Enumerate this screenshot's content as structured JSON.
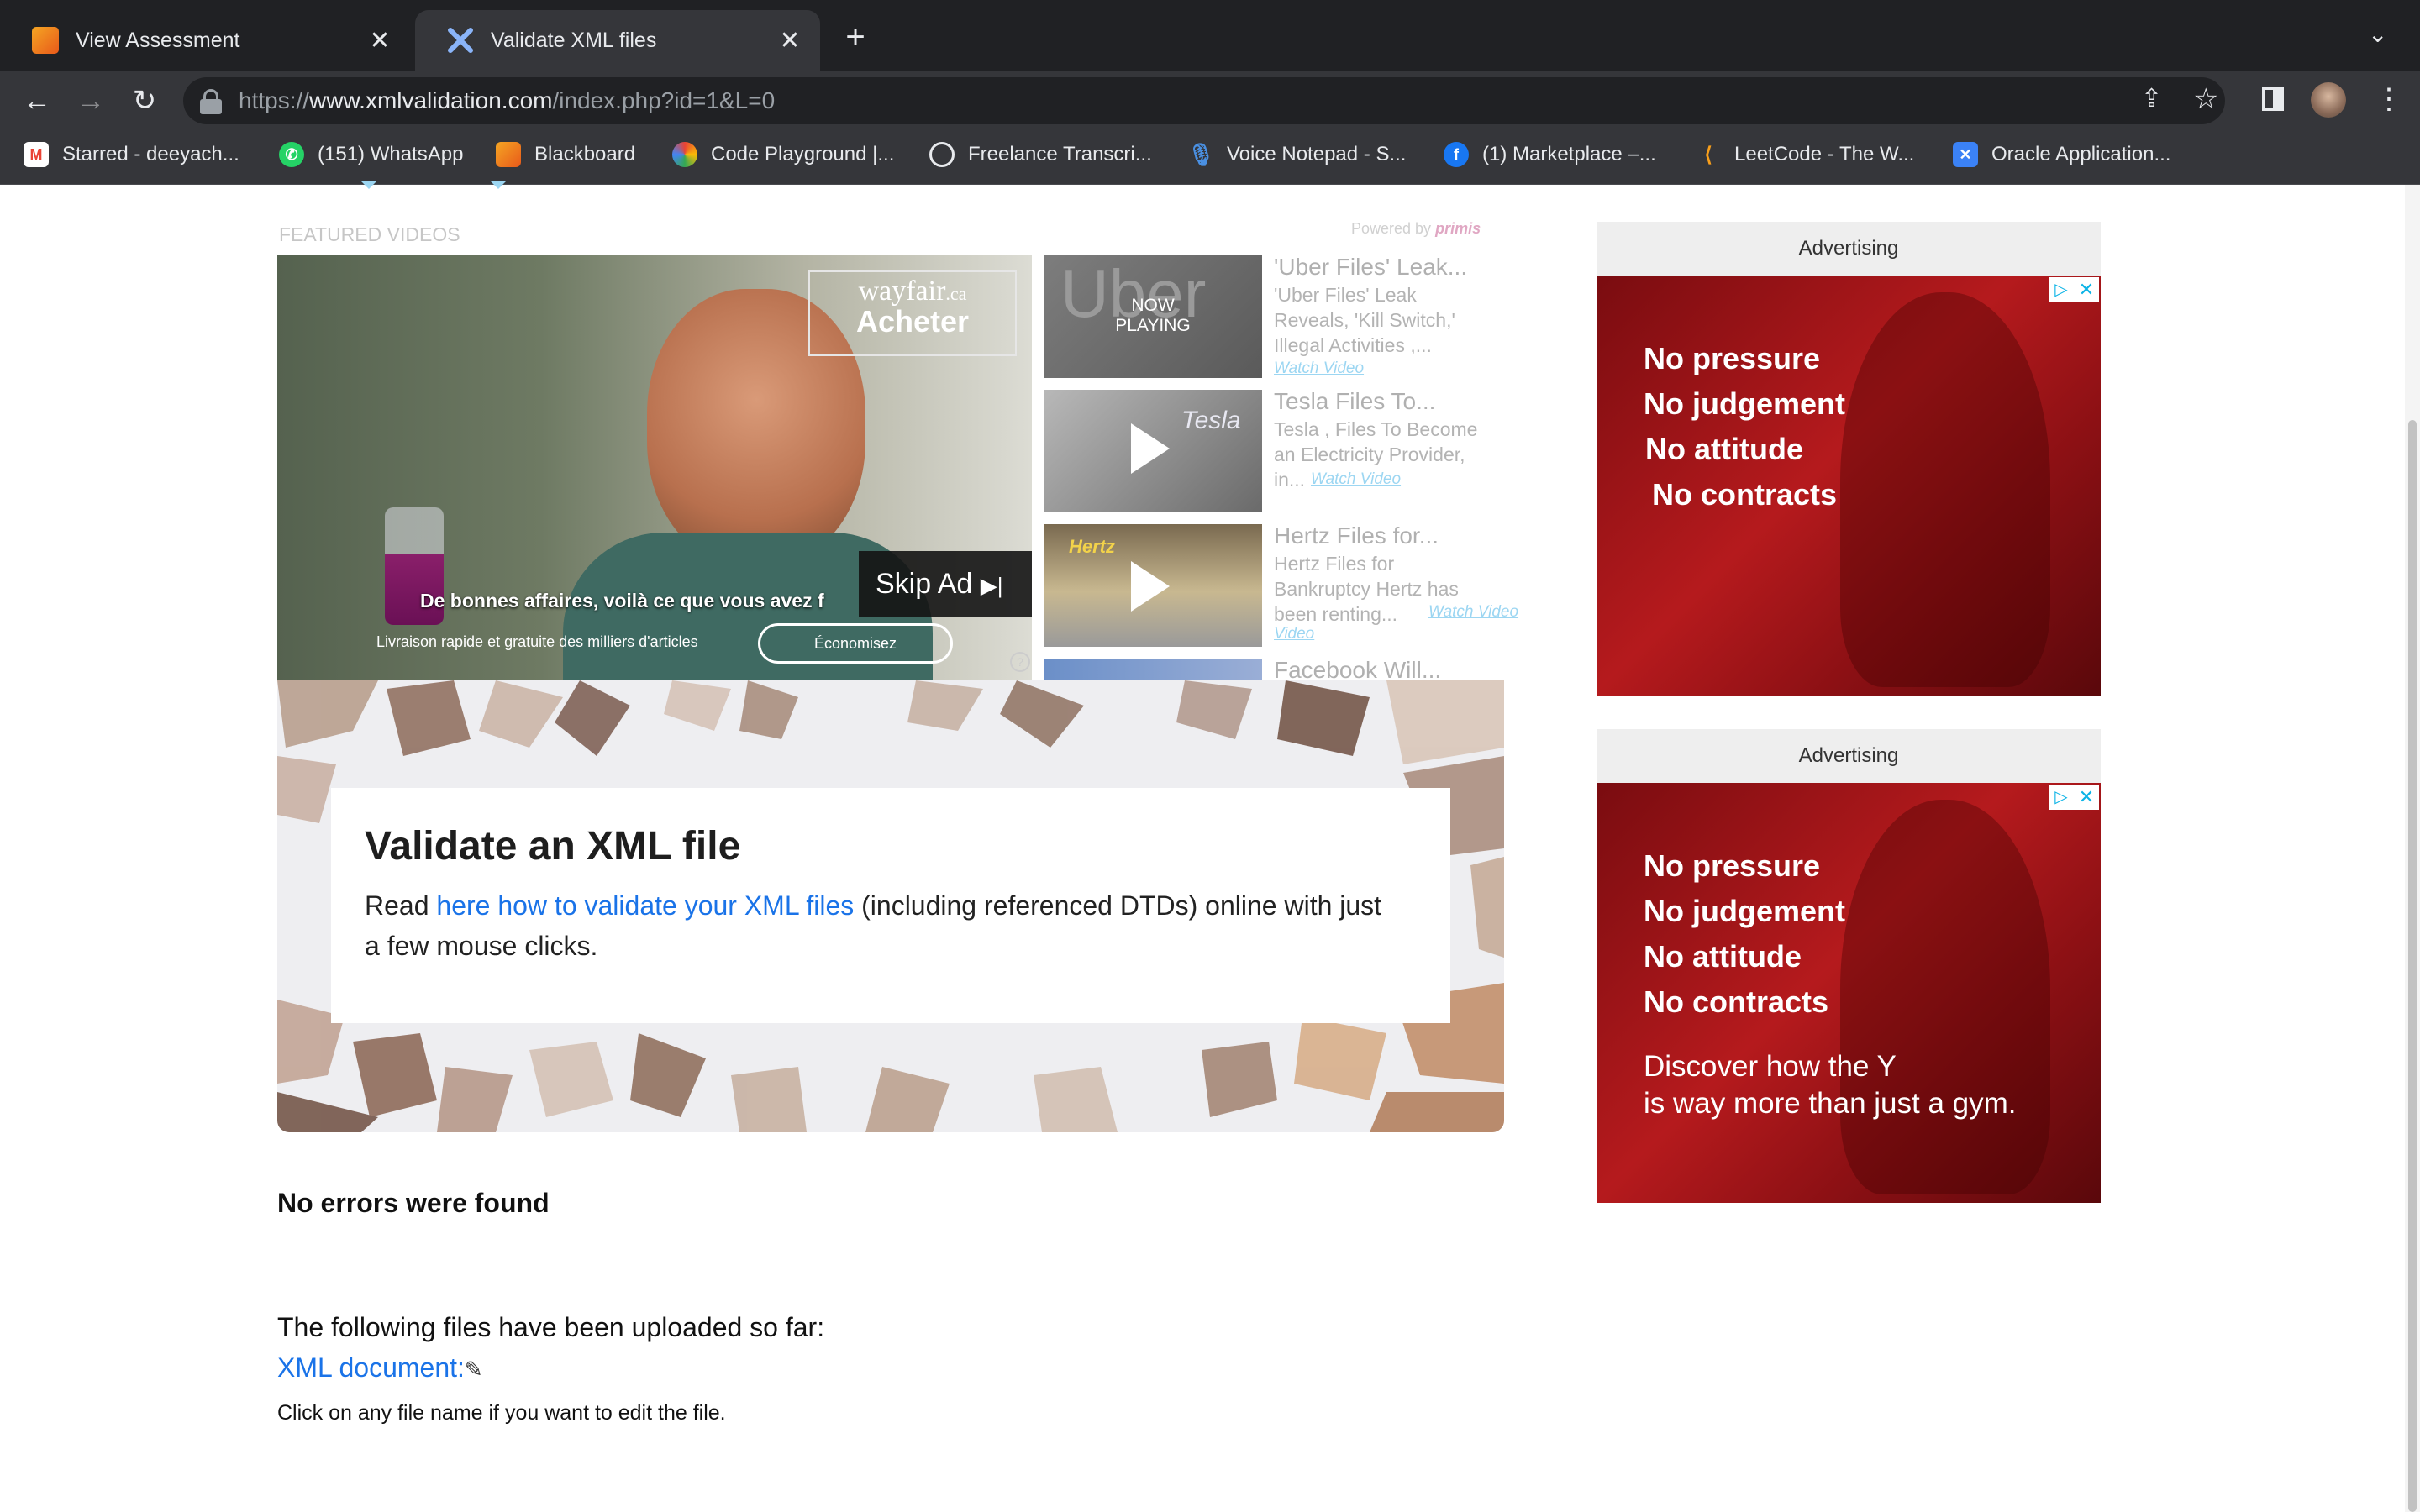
{
  "browser": {
    "tabs": [
      {
        "title": "View Assessment",
        "active": false
      },
      {
        "title": "Validate XML files",
        "active": true
      }
    ],
    "url_scheme": "https://",
    "url_host": "www.xmlvalidation.com",
    "url_path": "/index.php?id=1&L=0",
    "bookmarks": [
      {
        "label": "Starred - deeyach...",
        "icon": "gmail-icon"
      },
      {
        "label": "(151) WhatsApp",
        "icon": "whatsapp-icon"
      },
      {
        "label": "Blackboard",
        "icon": "blackboard-icon"
      },
      {
        "label": "Code Playground |...",
        "icon": "code-playground-icon"
      },
      {
        "label": "Freelance Transcri...",
        "icon": "freelance-icon"
      },
      {
        "label": "Voice Notepad - S...",
        "icon": "microphone-icon"
      },
      {
        "label": "(1) Marketplace –...",
        "icon": "facebook-icon"
      },
      {
        "label": "LeetCode - The W...",
        "icon": "leetcode-icon"
      },
      {
        "label": "Oracle Application...",
        "icon": "oracle-icon"
      }
    ]
  },
  "video": {
    "section_label": "FEATURED VIDEOS",
    "powered_by": "Powered by",
    "powered_brand": "primis",
    "ad_brand": "wayfair",
    "ad_brand_suffix": ".ca",
    "ad_cta": "Acheter",
    "ad_headline": "De bonnes affaires, voilà ce que vous avez f",
    "ad_subline": "Livraison rapide et gratuite des milliers d'articles",
    "ad_button": "Économisez",
    "skip_label": "Skip Ad",
    "now_playing": "NOW PLAYING",
    "playlist": [
      {
        "title": "'Uber Files' Leak...",
        "desc": "'Uber Files' Leak Reveals, 'Kill Switch,' Illegal Activities ,...",
        "link": "Watch Video",
        "thumb_text": "Uber"
      },
      {
        "title": "Tesla Files To...",
        "desc": "Tesla , Files To Become an Electricity Provider, in...",
        "link": "Watch Video",
        "thumb_text": "Tesla"
      },
      {
        "title": "Hertz Files for...",
        "desc": "Hertz Files for Bankruptcy Hertz has been renting...",
        "link": "Watch Video",
        "thumb_text": "Hertz"
      },
      {
        "title": "Facebook Will...",
        "desc": "",
        "link": "",
        "thumb_text": ""
      }
    ]
  },
  "hero": {
    "title": "Validate an XML file",
    "text_before": "Read ",
    "link": "here how to validate your XML files",
    "text_after_line1": " (including referenced DTDs) online with just",
    "text_line2": "a few mouse clicks."
  },
  "result": {
    "status": "No errors were found",
    "uploaded_heading": "The following files have been uploaded so far:",
    "file_link": "XML document:",
    "hint": "Click on any file name if you want to edit the file."
  },
  "ads": [
    {
      "label": "Advertising",
      "lines": [
        "No pressure",
        "No judgement",
        "No attitude",
        "No contracts"
      ],
      "tagline": []
    },
    {
      "label": "Advertising",
      "lines": [
        "No pressure",
        "No judgement",
        "No attitude",
        "No contracts"
      ],
      "tagline": [
        "Discover how the Y",
        "is way more than just a gym."
      ]
    }
  ],
  "colors": {
    "link": "#1a73e8",
    "ad_red": "#b51a1d",
    "chrome_dark": "#202124"
  }
}
